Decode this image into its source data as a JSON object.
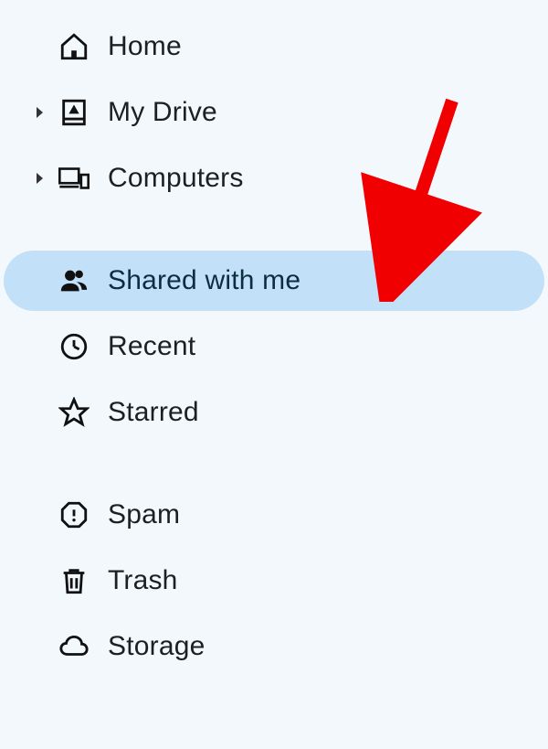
{
  "sidebar": {
    "items": [
      {
        "label": "Home"
      },
      {
        "label": "My Drive"
      },
      {
        "label": "Computers"
      },
      {
        "label": "Shared with me"
      },
      {
        "label": "Recent"
      },
      {
        "label": "Starred"
      },
      {
        "label": "Spam"
      },
      {
        "label": "Trash"
      },
      {
        "label": "Storage"
      }
    ],
    "selected_index": 3
  },
  "annotation": {
    "arrow_color": "#f00000"
  }
}
